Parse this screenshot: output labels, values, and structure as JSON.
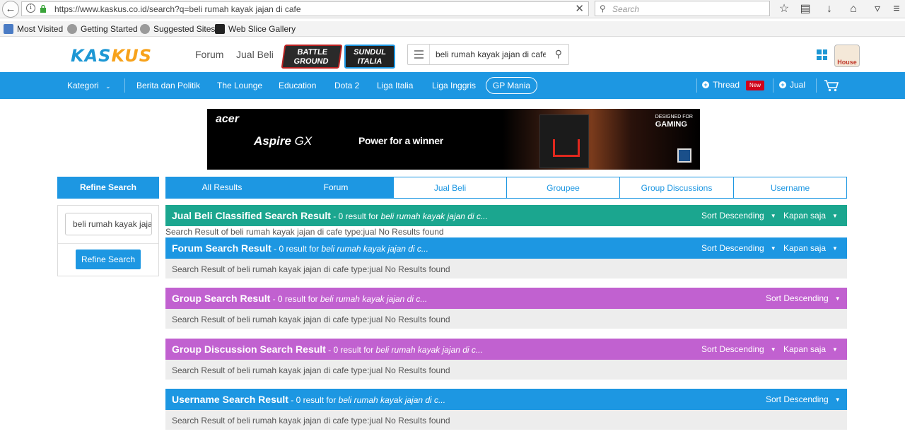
{
  "browser": {
    "url": "https://www.kaskus.co.id/search?q=beli rumah kayak jajan di cafe",
    "search_placeholder": "Search",
    "bookmarks": [
      "Most Visited",
      "Getting Started",
      "Suggested Sites",
      "Web Slice Gallery"
    ]
  },
  "header": {
    "logo_part1": "KAS",
    "logo_part2": "KUS",
    "links": [
      "Forum",
      "Jual Beli"
    ],
    "promo1": "BATTLE GROUND",
    "promo2": "SUNDUL ITALIA",
    "search_value": "beli rumah kayak jajan di cafe",
    "avatar_label": "House"
  },
  "nav": {
    "kategori": "Kategori",
    "items": [
      "Berita dan Politik",
      "The Lounge",
      "Education",
      "Dota 2",
      "Liga Italia",
      "Liga Inggris"
    ],
    "pill": "GP Mania",
    "thread": "Thread",
    "new_badge": "New",
    "jual": "Jual"
  },
  "banner": {
    "brand": "acer",
    "model_bold": "Aspire",
    "model_rest": " GX",
    "tagline": "Power for a winner",
    "designed_small": "DESIGNED FOR",
    "designed_big": "GAMING"
  },
  "refine": {
    "header": "Refine Search",
    "input_value": "beli rumah kayak jajan di cafe",
    "button": "Refine Search"
  },
  "tabs": [
    "All Results",
    "Forum",
    "Jual Beli",
    "Groupee",
    "Group Discussions",
    "Username"
  ],
  "results": {
    "jualbeli_title": "Jual Beli Classified Search Result",
    "forum_title": "Forum Search Result",
    "group_title": "Group Search Result",
    "discussion_title": "Group Discussion Search Result",
    "username_title": "Username Search Result",
    "count_text": " - 0 result for ",
    "query_short": "beli rumah kayak jajan di c...",
    "sort": "Sort Descending",
    "time": "Kapan saja",
    "no_results": "Search Result of beli rumah kayak jajan di cafe type:jual No Results found"
  },
  "colors": {
    "kaskus_blue": "#1d97e2",
    "jualbeli_green": "#1ba68f",
    "group_purple": "#c161d0",
    "logo_orange": "#f7a21b"
  }
}
